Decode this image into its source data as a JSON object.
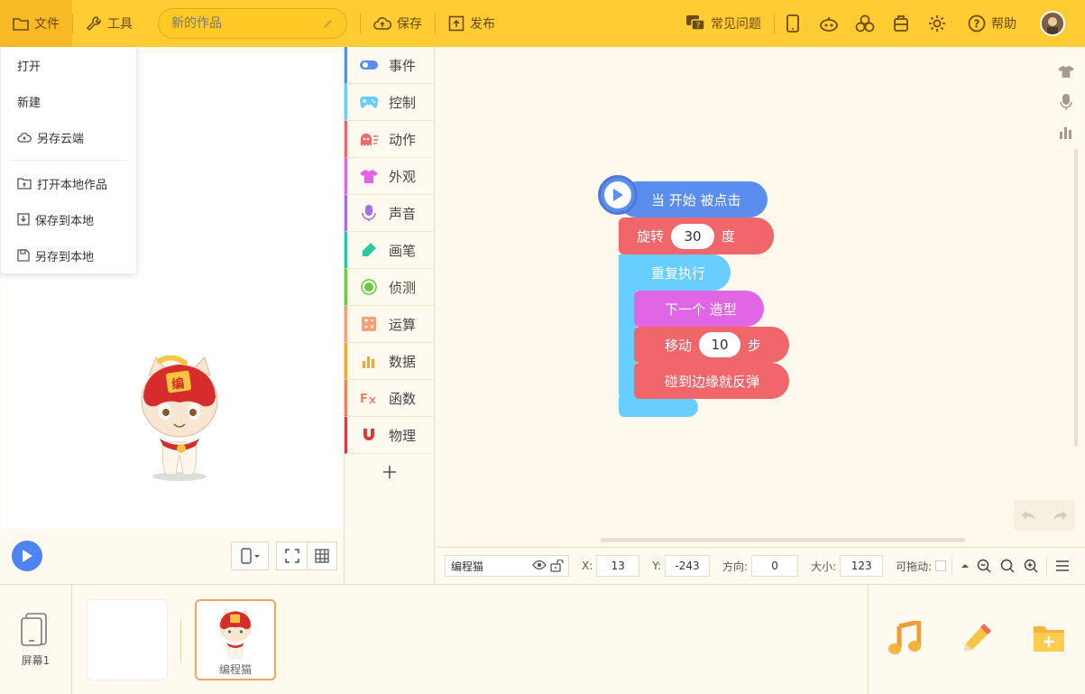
{
  "topbar": {
    "file_label": "文件",
    "tools_label": "工具",
    "title_value": "",
    "title_placeholder": "新的作品",
    "save_label": "保存",
    "publish_label": "发布",
    "faq_label": "常见问题",
    "help_label": "帮助"
  },
  "file_menu": {
    "items": [
      {
        "label": "打开"
      },
      {
        "label": "新建"
      },
      {
        "label": "另存云端"
      },
      {
        "label": "打开本地作品"
      },
      {
        "label": "保存到本地"
      },
      {
        "label": "另存到本地"
      }
    ]
  },
  "categories": [
    {
      "label": "事件",
      "color": "#5b8def"
    },
    {
      "label": "控制",
      "color": "#68cdff"
    },
    {
      "label": "动作",
      "color": "#f0666b"
    },
    {
      "label": "外观",
      "color": "#e066e6"
    },
    {
      "label": "声音",
      "color": "#a66ee6"
    },
    {
      "label": "画笔",
      "color": "#2ec7a0"
    },
    {
      "label": "侦测",
      "color": "#66cc44"
    },
    {
      "label": "运算",
      "color": "#f5a07a"
    },
    {
      "label": "数据",
      "color": "#f2a534"
    },
    {
      "label": "函数",
      "color": "#f07f5a"
    },
    {
      "label": "物理",
      "color": "#d63c3c"
    }
  ],
  "blocks": {
    "hat": "当 开始 被点击",
    "rotate_prefix": "旋转",
    "rotate_value": "30",
    "rotate_suffix": "度",
    "repeat": "重复执行",
    "next_costume": "下一个 造型",
    "move_prefix": "移动",
    "move_value": "10",
    "move_suffix": "步",
    "bounce": "碰到边缘就反弹"
  },
  "props": {
    "sprite_name": "编程猫",
    "x_label": "X:",
    "x_value": "13",
    "y_label": "Y:",
    "y_value": "-243",
    "dir_label": "方向:",
    "dir_value": "0",
    "size_label": "大小:",
    "size_value": "123",
    "drag_label": "可拖动:"
  },
  "bottom": {
    "screen_label": "屏幕1",
    "sprite_label": "编程猫"
  }
}
